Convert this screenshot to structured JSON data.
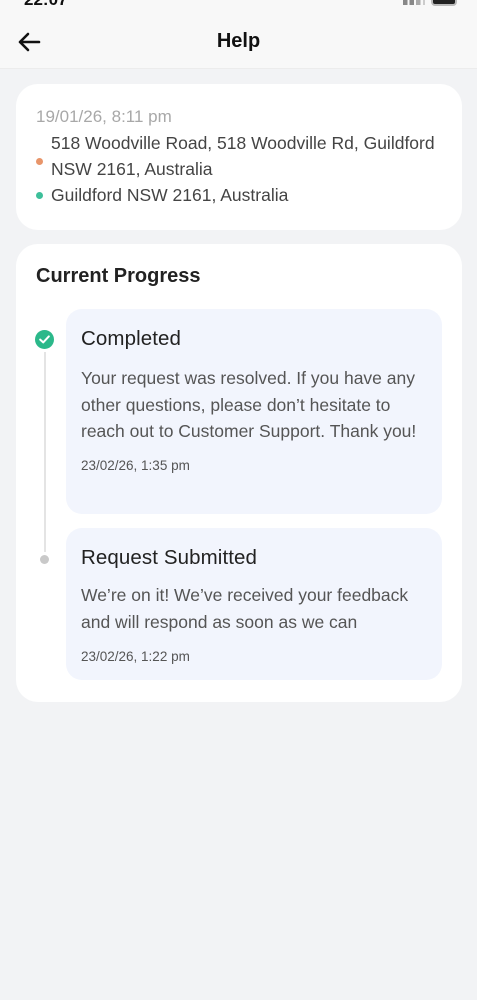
{
  "header": {
    "title": "Help",
    "back_icon": "arrow-left-icon"
  },
  "trip": {
    "date": "19/01/26, 8:11 pm",
    "from": "518 Woodville Road, 518 Woodville Rd, Guildford NSW 2161, Australia",
    "to": "Guildford NSW 2161, Australia",
    "from_dot_color": "#e8956a",
    "to_dot_color": "#3dbf9a"
  },
  "progress": {
    "title": "Current Progress",
    "steps": [
      {
        "status": "done",
        "title": "Completed",
        "description": "Your request was resolved. If you have any other questions, please don’t hesitate to reach out to Customer Support. Thank you!",
        "time": "23/02/26, 1:35 pm"
      },
      {
        "status": "pending",
        "title": "Request Submitted",
        "description": "We’re on it! We’ve received your feedback and will respond as soon as we can",
        "time": "23/02/26, 1:22 pm"
      }
    ]
  },
  "colors": {
    "success": "#2bb88a",
    "step_background": "#f2f5fd",
    "page_background": "#f2f3f5"
  }
}
